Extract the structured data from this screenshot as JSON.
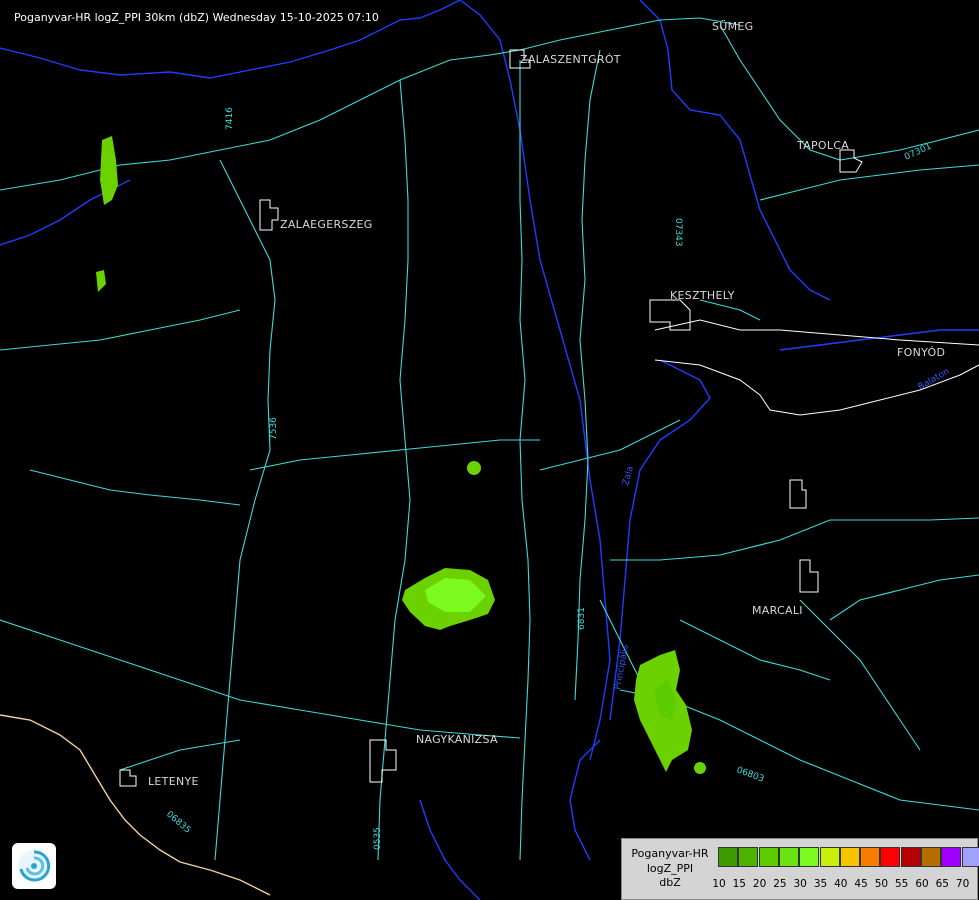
{
  "header": {
    "title": "Poganyvar-HR logZ_PPI 30km (dbZ) Wednesday 15-10-2025 07:10"
  },
  "cities": [
    {
      "name": "SÜMEG"
    },
    {
      "name": "ZALASZENTGRÓT"
    },
    {
      "name": "TAPOLCA"
    },
    {
      "name": "ZALAEGERSZEG"
    },
    {
      "name": "KESZTHELY"
    },
    {
      "name": "FONYÓD"
    },
    {
      "name": "MARCALI"
    },
    {
      "name": "NAGYKANIZSA"
    },
    {
      "name": "LETENYE"
    }
  ],
  "road_labels": [
    "7416",
    "07343",
    "07301",
    "7536",
    "6831",
    "06803",
    "0535",
    "06835"
  ],
  "river_labels": [
    "Zala",
    "Principális",
    "Balaton"
  ],
  "colors": {
    "background": "#000000",
    "roads": "#3fd9d9",
    "settlements": "#ffffff",
    "rivers": "#1f3dff",
    "border": "#f3cf9c",
    "echo_light": "#6cd100",
    "echo_bright": "#7cf91e"
  },
  "legend": {
    "line1": "Poganyvar-HR",
    "line2": "logZ_PPI",
    "line3": "dbZ",
    "levels": [
      {
        "value": "10",
        "color": "#3c9b00"
      },
      {
        "value": "15",
        "color": "#4cb300"
      },
      {
        "value": "20",
        "color": "#5bcc00"
      },
      {
        "value": "25",
        "color": "#6ae314"
      },
      {
        "value": "30",
        "color": "#7cf91e"
      },
      {
        "value": "35",
        "color": "#c8f00a"
      },
      {
        "value": "40",
        "color": "#f5c400"
      },
      {
        "value": "45",
        "color": "#f57d00"
      },
      {
        "value": "50",
        "color": "#ff0000"
      },
      {
        "value": "55",
        "color": "#b40000"
      },
      {
        "value": "60",
        "color": "#b46e00"
      },
      {
        "value": "65",
        "color": "#a000ff"
      },
      {
        "value": "70",
        "color": "#a0a0ff"
      }
    ]
  }
}
